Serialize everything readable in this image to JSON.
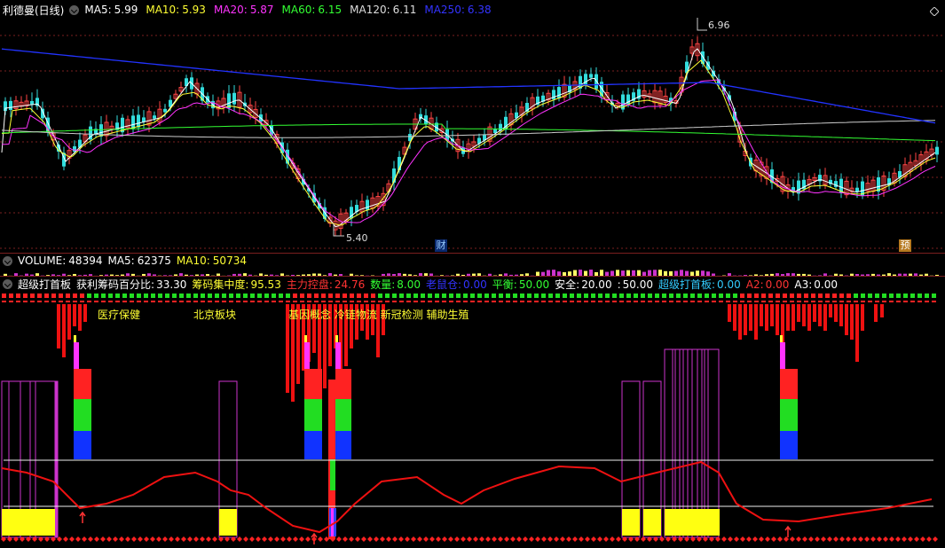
{
  "kline": {
    "title": "利德曼(日线)",
    "ma": [
      {
        "label": "MA5:",
        "value": "5.99",
        "color": "#ffffff"
      },
      {
        "label": "MA10:",
        "value": "5.93",
        "color": "#ffff33"
      },
      {
        "label": "MA20:",
        "value": "5.87",
        "color": "#ff33ff"
      },
      {
        "label": "MA60:",
        "value": "6.15",
        "color": "#33ff33"
      },
      {
        "label": "MA120:",
        "value": "6.11",
        "color": "#dddddd"
      },
      {
        "label": "MA250:",
        "value": "6.38",
        "color": "#3333ff"
      }
    ],
    "high_mark": "6.96",
    "low_mark": "5.40",
    "tag_cai": "财",
    "tag_yu": "预"
  },
  "volume": {
    "label": "VOLUME:",
    "value": "48394",
    "ma5_label": "MA5:",
    "ma5_value": "62375",
    "ma10_label": "MA10:",
    "ma10_value": "50734"
  },
  "indicator": {
    "name": "超级打首板",
    "items": [
      {
        "label": "获利筹码百分比:",
        "value": "33.30",
        "color": "#ffffff"
      },
      {
        "label": "筹码集中度:",
        "value": "95.53",
        "color": "#ffff33"
      },
      {
        "label": "主力控盘:",
        "value": "24.76",
        "color": "#ff3333"
      },
      {
        "label": "数量:",
        "value": "8.00",
        "color": "#33ff33"
      },
      {
        "label": "老鼠仓:",
        "value": "0.00",
        "color": "#3333ff"
      },
      {
        "label": "平衡:",
        "value": "50.00",
        "color": "#33ff33"
      },
      {
        "label": "安全:",
        "value": "20.00",
        "color": "#ffffff"
      },
      {
        "label": ":",
        "value": "50.00",
        "color": "#ffffff"
      },
      {
        "label": "超级打首板:",
        "value": "0.00",
        "color": "#33ccff"
      },
      {
        "label": "A2:",
        "value": "0.00",
        "color": "#ff3333"
      },
      {
        "label": "A3:",
        "value": "0.00",
        "color": "#ffffff"
      }
    ],
    "concept_1": "医疗保健",
    "concept_2": "北京板块",
    "concept_3": "基因概念 冷链物流 新冠检测 辅助生殖"
  }
}
